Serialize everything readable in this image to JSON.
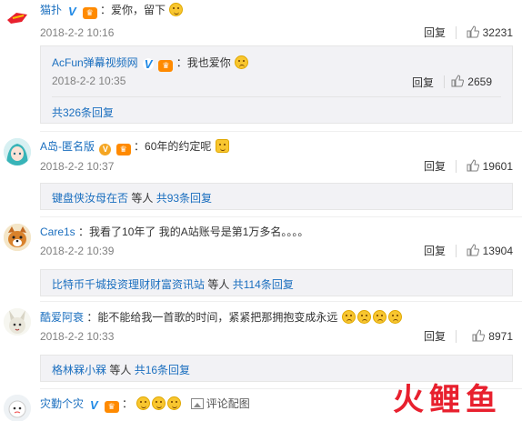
{
  "comments": [
    {
      "username": "猫扑",
      "text": "：爱你，留下",
      "date": "2018-2-2 10:16",
      "reply_label": "回复",
      "likes": "32231",
      "nested": {
        "username": "AcFun弹幕视频网",
        "text": "：我也爱你",
        "date": "2018-2-2 10:35",
        "reply_label": "回复",
        "likes": "2659",
        "more": "共326条回复"
      }
    },
    {
      "username": "A岛-匿名版",
      "text": "：60年的约定呢",
      "date": "2018-2-2 10:37",
      "reply_label": "回复",
      "likes": "19601",
      "replies_users": "键盘侠汝母在否",
      "replies_mid": " 等人 ",
      "replies_count": "共93条回复"
    },
    {
      "username": "Care1s",
      "text": "：我看了10年了 我的A站账号是第1万多名。。。。",
      "date": "2018-2-2 10:39",
      "reply_label": "回复",
      "likes": "13904",
      "replies_users": "比特币千城投资理财财富资讯站",
      "replies_mid": " 等人 ",
      "replies_count": "共114条回复"
    },
    {
      "username": "酷爱阿衰",
      "text": "：能不能给我一首歌的时间，紧紧把那拥抱变成永远",
      "date": "2018-2-2 10:33",
      "reply_label": "回复",
      "likes": "8971",
      "replies_users": "格林槑小槑",
      "replies_mid": " 等人 ",
      "replies_count": "共16条回复"
    },
    {
      "username": "灾勤个灾",
      "text": "：",
      "pic_label": "评论配图"
    }
  ],
  "watermark": "火鲤鱼",
  "colors": {
    "link": "#1b6fbf",
    "accent": "#eb7350",
    "watermark": "#e8202e"
  }
}
